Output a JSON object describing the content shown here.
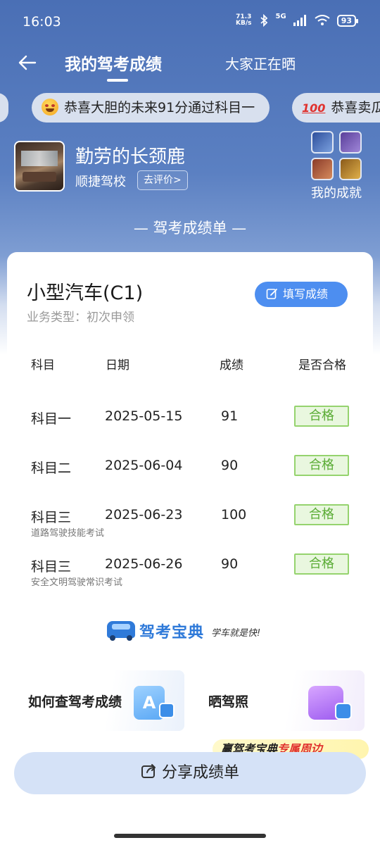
{
  "status_bar": {
    "time": "16:03",
    "net_speed_value": "71.3",
    "net_speed_unit": "KB/s",
    "network": "5G",
    "battery": "93"
  },
  "nav": {
    "title": "我的驾考成绩",
    "other_tab": "大家正在晒"
  },
  "ticker": {
    "items": [
      {
        "emoji": "star-struck-emoji",
        "text": "恭喜大胆的未来91分通过科目一"
      },
      {
        "emoji": "hundred-points-emoji",
        "emoji_text": "100",
        "text": "恭喜卖瓜"
      }
    ]
  },
  "profile": {
    "username": "勤劳的长颈鹿",
    "school": "顺捷驾校",
    "rate_button": "去评价>",
    "achievements_label": "我的成就"
  },
  "section_title": "— 驾考成绩单 —",
  "report": {
    "vehicle": "小型汽车(C1)",
    "business_type": "业务类型：初次申领",
    "fill_button": "填写成绩",
    "headers": {
      "subject": "科目",
      "date": "日期",
      "score": "成绩",
      "passed": "是否合格"
    },
    "rows": [
      {
        "subject": "科目一",
        "date": "2025-05-15",
        "score": "91",
        "status": "合格",
        "note": ""
      },
      {
        "subject": "科目二",
        "date": "2025-06-04",
        "score": "90",
        "status": "合格",
        "note": ""
      },
      {
        "subject": "科目三",
        "date": "2025-06-23",
        "score": "100",
        "status": "合格",
        "note": "道路驾驶技能考试"
      },
      {
        "subject": "科目三",
        "date": "2025-06-26",
        "score": "90",
        "status": "合格",
        "note": "安全文明驾驶常识考试"
      }
    ],
    "brand_name": "驾考宝典",
    "brand_slogan": "学车就是快!"
  },
  "help_cards": {
    "left_label": "如何查驾考成绩",
    "right_label": "晒驾照"
  },
  "promo": {
    "prefix": "赢驾考宝典",
    "accent": "专属周边"
  },
  "share_button": "分享成绩单",
  "colors": {
    "header_blue": "#4a6fb5",
    "accent_blue": "#4d8ef0",
    "pass_green": "#5aac35",
    "share_bg": "#d5e2f7"
  }
}
